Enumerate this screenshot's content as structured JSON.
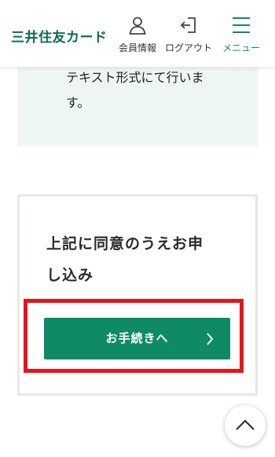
{
  "header": {
    "logo_text": "三井住友カード",
    "member_label": "会員情報",
    "logout_label": "ログアウト",
    "menu_label": "メニュー"
  },
  "info_panel": {
    "line1": "テキスト形式にて行いま",
    "line2": "す。"
  },
  "consent": {
    "heading_line1": "上記に同意のうえお申",
    "heading_line2": "し込み",
    "proceed_label": "お手続きへ"
  },
  "colors": {
    "brand_green": "#0e8a65",
    "logo_green": "#0e6b4c",
    "highlight_red": "#e8121b",
    "panel_bg": "#eef6f3"
  },
  "icons": {
    "member": "person-icon",
    "logout": "logout-icon",
    "menu": "hamburger-icon",
    "proceed": "chevron-right-icon",
    "back_to_top": "chevron-up-icon"
  }
}
